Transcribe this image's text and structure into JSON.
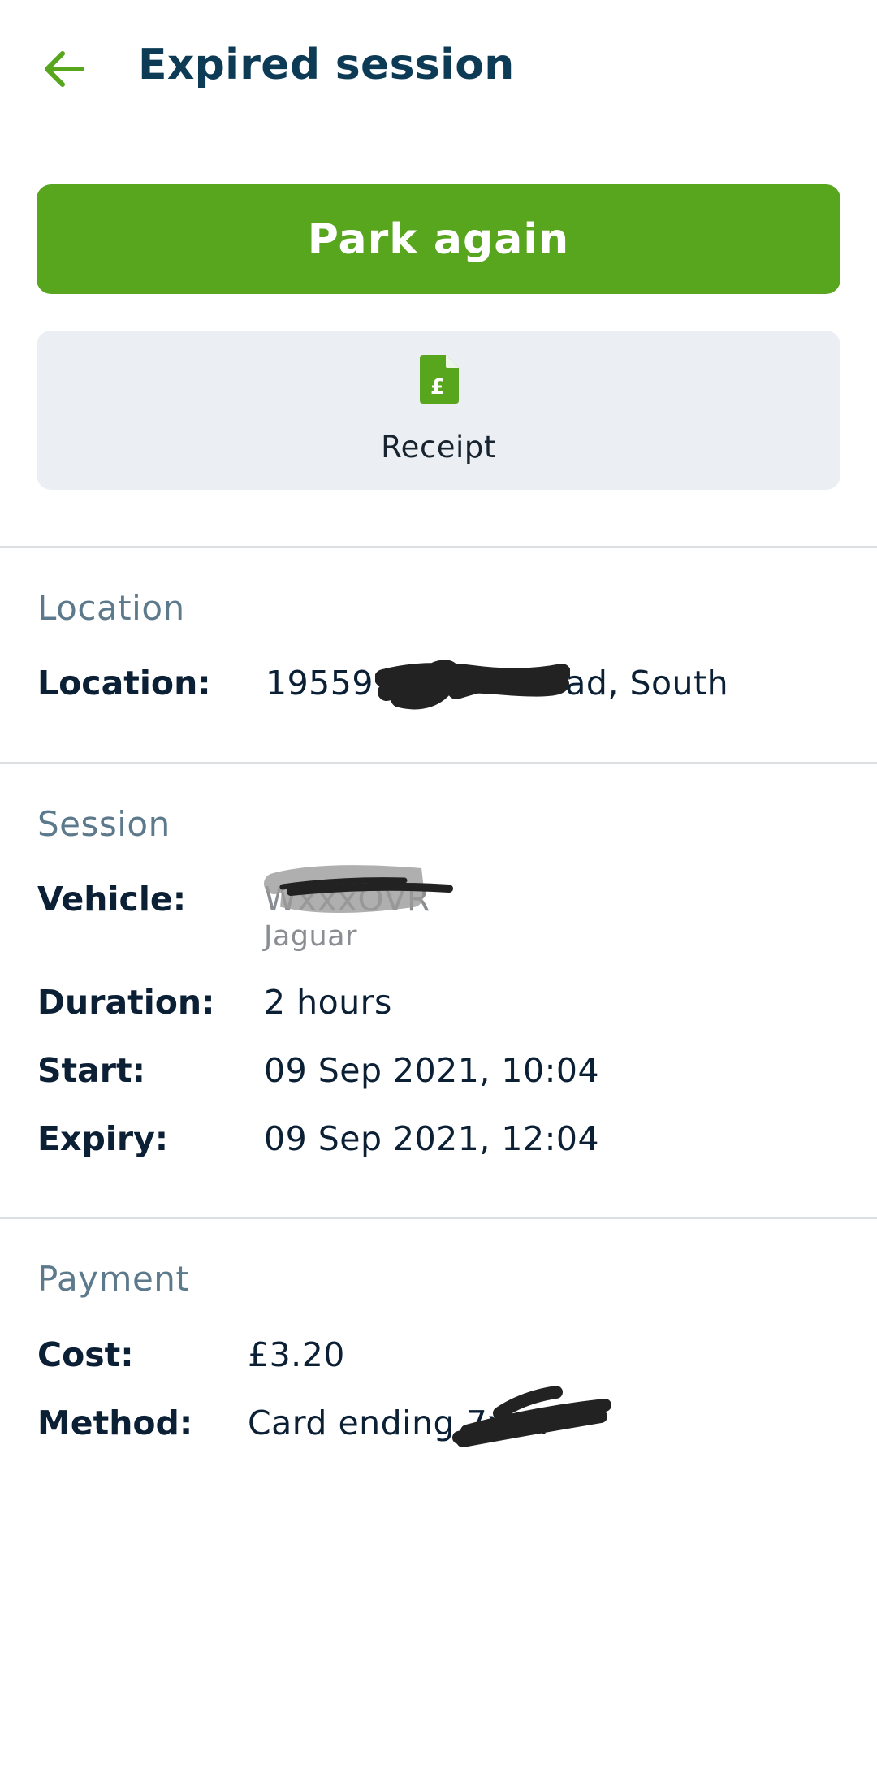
{
  "header": {
    "title": "Expired session"
  },
  "actions": {
    "park_again": "Park again",
    "receipt": "Receipt"
  },
  "location_section": {
    "title": "Location",
    "location_label": "Location:",
    "location_value": "19559 - Bxxxx Road, South"
  },
  "session_section": {
    "title": "Session",
    "vehicle_label": "Vehicle:",
    "vehicle_reg": "WxxxOVR",
    "vehicle_make": "Jaguar",
    "duration_label": "Duration:",
    "duration_value": "2 hours",
    "start_label": "Start:",
    "start_value": "09 Sep 2021, 10:04",
    "expiry_label": "Expiry:",
    "expiry_value": "09 Sep 2021, 12:04"
  },
  "payment_section": {
    "title": "Payment",
    "cost_label": "Cost:",
    "cost_value": "£3.20",
    "method_label": "Method:",
    "method_value": "Card ending 7xxx"
  },
  "colors": {
    "primary_green": "#58a51e",
    "title_blue": "#0d3b56",
    "section_grey": "#5d7a8d",
    "receipt_bg": "#ebeff4"
  },
  "icons": {
    "back": "arrow-left-icon",
    "receipt": "document-pound-icon"
  }
}
